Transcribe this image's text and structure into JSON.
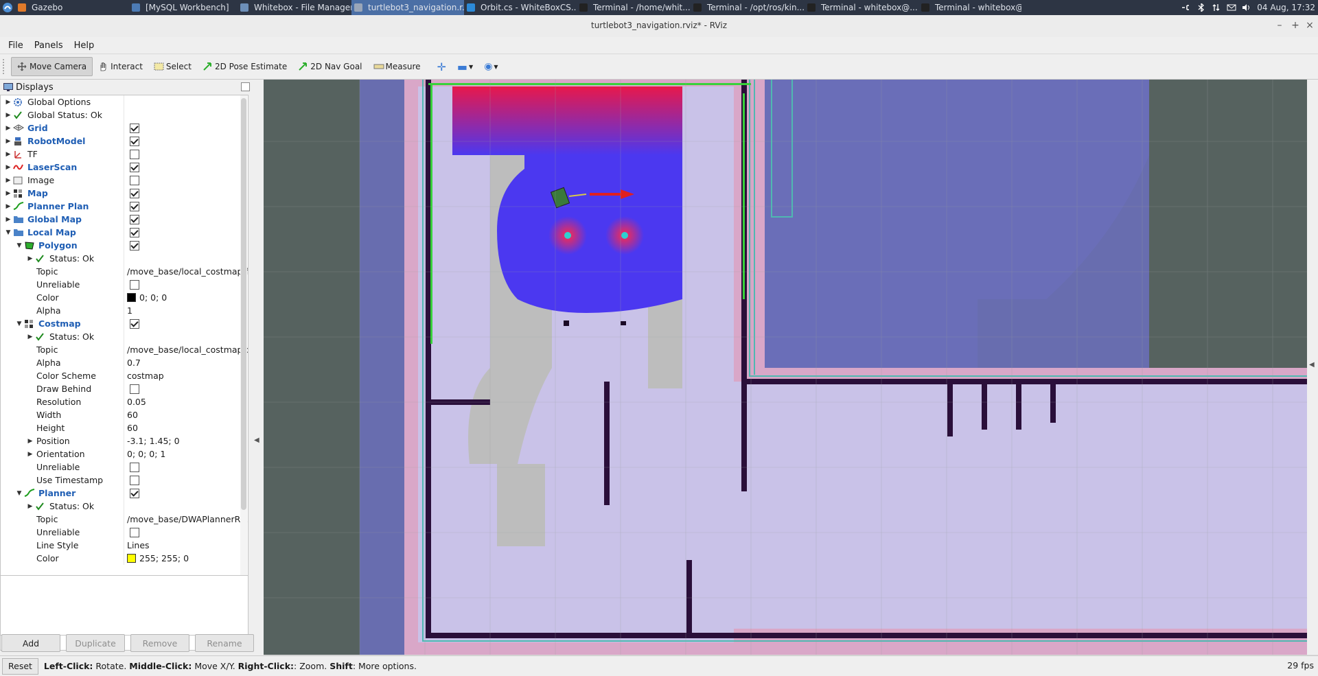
{
  "taskbar": {
    "items": [
      {
        "label": "Gazebo",
        "color": "#e07a2a",
        "active": false,
        "width": 166
      },
      {
        "label": "[MySQL Workbench]",
        "color": "#4c7bb5",
        "active": false,
        "width": 158
      },
      {
        "label": "Whitebox - File Manager",
        "color": "#6d8fb8",
        "active": false,
        "width": 166
      },
      {
        "label": "turtlebot3_navigation.r...",
        "color": "#9aa6b8",
        "active": true,
        "width": 164
      },
      {
        "label": "Orbit.cs - WhiteBoxCS...",
        "color": "#2c8ad8",
        "active": false,
        "width": 164
      },
      {
        "label": "Terminal - /home/whit...",
        "color": "#222222",
        "active": false,
        "width": 166
      },
      {
        "label": "Terminal - /opt/ros/kin...",
        "color": "#222222",
        "active": false,
        "width": 166
      },
      {
        "label": "Terminal - whitebox@...",
        "color": "#222222",
        "active": false,
        "width": 166
      },
      {
        "label": "Terminal - whitebox@...",
        "color": "#222222",
        "active": false,
        "width": 150
      }
    ],
    "clock": "04 Aug, 17:32"
  },
  "window": {
    "title": "turtlebot3_navigation.rviz* - RViz"
  },
  "menu": [
    "File",
    "Panels",
    "Help"
  ],
  "toolbar": {
    "move_camera": "Move Camera",
    "interact": "Interact",
    "select": "Select",
    "pose_estimate": "2D Pose Estimate",
    "nav_goal": "2D Nav Goal",
    "measure": "Measure"
  },
  "displays": {
    "title": "Displays",
    "rows": [
      {
        "label": "Global Options",
        "value": "",
        "indent": 0,
        "arrow": "▶",
        "icon": "gear",
        "blue": false,
        "check": null
      },
      {
        "label": "Global Status: Ok",
        "value": "",
        "indent": 0,
        "arrow": "▶",
        "icon": "ok",
        "blue": false,
        "check": null
      },
      {
        "label": "Grid",
        "value": "",
        "indent": 0,
        "arrow": "▶",
        "icon": "grid",
        "blue": true,
        "check": true
      },
      {
        "label": "RobotModel",
        "value": "",
        "indent": 0,
        "arrow": "▶",
        "icon": "robot",
        "blue": true,
        "check": true
      },
      {
        "label": "TF",
        "value": "",
        "indent": 0,
        "arrow": "▶",
        "icon": "tf",
        "blue": false,
        "check": false
      },
      {
        "label": "LaserScan",
        "value": "",
        "indent": 0,
        "arrow": "▶",
        "icon": "laser",
        "blue": true,
        "check": true
      },
      {
        "label": "Image",
        "value": "",
        "indent": 0,
        "arrow": "▶",
        "icon": "image",
        "blue": false,
        "check": false
      },
      {
        "label": "Map",
        "value": "",
        "indent": 0,
        "arrow": "▶",
        "icon": "map",
        "blue": true,
        "check": true
      },
      {
        "label": "Planner Plan",
        "value": "",
        "indent": 0,
        "arrow": "▶",
        "icon": "path",
        "blue": true,
        "check": true
      },
      {
        "label": "Global Map",
        "value": "",
        "indent": 0,
        "arrow": "▶",
        "icon": "folder",
        "blue": true,
        "check": true
      },
      {
        "label": "Local Map",
        "value": "",
        "indent": 0,
        "arrow": "▼",
        "icon": "folder",
        "blue": true,
        "check": true
      },
      {
        "label": "Polygon",
        "value": "",
        "indent": 1,
        "arrow": "▼",
        "icon": "polygon",
        "blue": true,
        "check": true
      },
      {
        "label": "Status: Ok",
        "value": "",
        "indent": 2,
        "arrow": "▶",
        "icon": "ok",
        "blue": false,
        "check": null
      },
      {
        "label": "Topic",
        "value": "/move_base/local_costmap/f...",
        "indent": 2,
        "arrow": "",
        "icon": "",
        "blue": false,
        "check": null
      },
      {
        "label": "Unreliable",
        "value": "",
        "indent": 2,
        "arrow": "",
        "icon": "",
        "blue": false,
        "check": false
      },
      {
        "label": "Color",
        "value": "0; 0; 0",
        "indent": 2,
        "arrow": "",
        "icon": "",
        "blue": false,
        "check": null,
        "swatch": "#000000"
      },
      {
        "label": "Alpha",
        "value": "1",
        "indent": 2,
        "arrow": "",
        "icon": "",
        "blue": false,
        "check": null
      },
      {
        "label": "Costmap",
        "value": "",
        "indent": 1,
        "arrow": "▼",
        "icon": "map",
        "blue": true,
        "check": true
      },
      {
        "label": "Status: Ok",
        "value": "",
        "indent": 2,
        "arrow": "▶",
        "icon": "ok",
        "blue": false,
        "check": null
      },
      {
        "label": "Topic",
        "value": "/move_base/local_costmap/c...",
        "indent": 2,
        "arrow": "",
        "icon": "",
        "blue": false,
        "check": null
      },
      {
        "label": "Alpha",
        "value": "0.7",
        "indent": 2,
        "arrow": "",
        "icon": "",
        "blue": false,
        "check": null
      },
      {
        "label": "Color Scheme",
        "value": "costmap",
        "indent": 2,
        "arrow": "",
        "icon": "",
        "blue": false,
        "check": null
      },
      {
        "label": "Draw Behind",
        "value": "",
        "indent": 2,
        "arrow": "",
        "icon": "",
        "blue": false,
        "check": false
      },
      {
        "label": "Resolution",
        "value": "0.05",
        "indent": 2,
        "arrow": "",
        "icon": "",
        "blue": false,
        "check": null
      },
      {
        "label": "Width",
        "value": "60",
        "indent": 2,
        "arrow": "",
        "icon": "",
        "blue": false,
        "check": null
      },
      {
        "label": "Height",
        "value": "60",
        "indent": 2,
        "arrow": "",
        "icon": "",
        "blue": false,
        "check": null
      },
      {
        "label": "Position",
        "value": "-3.1; 1.45; 0",
        "indent": 2,
        "arrow": "▶",
        "icon": "",
        "blue": false,
        "check": null
      },
      {
        "label": "Orientation",
        "value": "0; 0; 0; 1",
        "indent": 2,
        "arrow": "▶",
        "icon": "",
        "blue": false,
        "check": null
      },
      {
        "label": "Unreliable",
        "value": "",
        "indent": 2,
        "arrow": "",
        "icon": "",
        "blue": false,
        "check": false
      },
      {
        "label": "Use Timestamp",
        "value": "",
        "indent": 2,
        "arrow": "",
        "icon": "",
        "blue": false,
        "check": false
      },
      {
        "label": "Planner",
        "value": "",
        "indent": 1,
        "arrow": "▼",
        "icon": "path",
        "blue": true,
        "check": true
      },
      {
        "label": "Status: Ok",
        "value": "",
        "indent": 2,
        "arrow": "▶",
        "icon": "ok",
        "blue": false,
        "check": null
      },
      {
        "label": "Topic",
        "value": "/move_base/DWAPlannerRO...",
        "indent": 2,
        "arrow": "",
        "icon": "",
        "blue": false,
        "check": null
      },
      {
        "label": "Unreliable",
        "value": "",
        "indent": 2,
        "arrow": "",
        "icon": "",
        "blue": false,
        "check": false
      },
      {
        "label": "Line Style",
        "value": "Lines",
        "indent": 2,
        "arrow": "",
        "icon": "",
        "blue": false,
        "check": null
      },
      {
        "label": "Color",
        "value": "255; 255; 0",
        "indent": 2,
        "arrow": "",
        "icon": "",
        "blue": false,
        "check": null,
        "swatch": "#ffff00"
      }
    ]
  },
  "buttons": {
    "add": "Add",
    "duplicate": "Duplicate",
    "remove": "Remove",
    "rename": "Rename"
  },
  "status": {
    "reset": "Reset",
    "hint_parts": [
      {
        "text": "Left-Click:",
        "bold": true
      },
      {
        "text": " Rotate. ",
        "bold": false
      },
      {
        "text": "Middle-Click:",
        "bold": true
      },
      {
        "text": " Move X/Y. ",
        "bold": false
      },
      {
        "text": "Right-Click:",
        "bold": true
      },
      {
        "text": ": Zoom. ",
        "bold": false
      },
      {
        "text": "Shift",
        "bold": true
      },
      {
        "text": ": More options.",
        "bold": false
      }
    ],
    "fps": "29 fps"
  },
  "colors": {
    "accent": "#1f5eb4",
    "taskbar": "#2d3544",
    "active_task": "#4b6fa5",
    "view_bg": "#56625f"
  }
}
